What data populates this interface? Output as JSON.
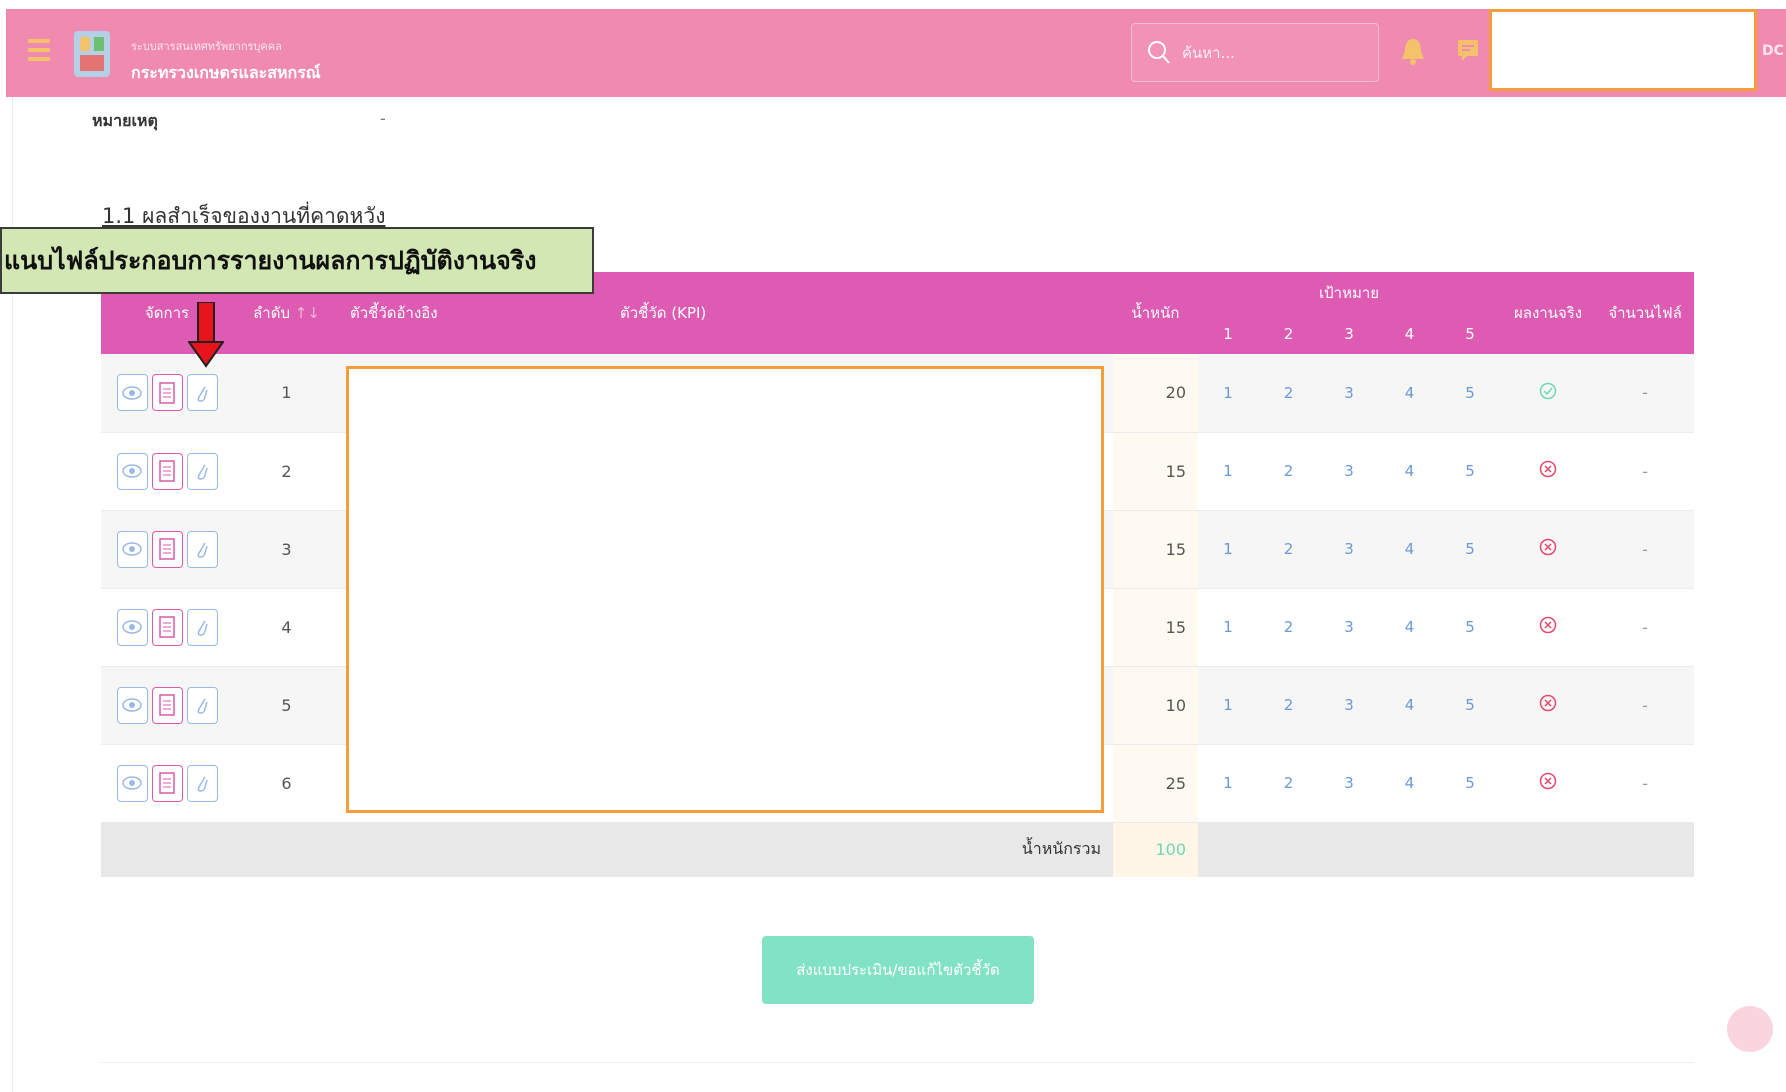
{
  "header": {
    "brand_top": "ระบบสารสนเทศทรัพยากรบุคคล",
    "brand_main": "กระทรวงเกษตรและสหกรณ์",
    "search_placeholder": "ค้นหา...",
    "user_initials": "DC"
  },
  "remark": {
    "label": "หมายเหตุ",
    "value": "-"
  },
  "section": {
    "title": "1.1 ผลสำเร็จของงานที่คาดหวัง"
  },
  "tooltip": {
    "text": "แนบไฟล์ประกอบการรายงานผลการปฏิบัติงานจริง"
  },
  "table": {
    "headers": {
      "manage": "จัดการ",
      "order": "ลำดับ",
      "ref_indicator": "ตัวชี้วัดอ้างอิง",
      "kpi": "ตัวชี้วัด (KPI)",
      "weight": "น้ำหนัก",
      "target": "เป้าหมาย",
      "targets": [
        "1",
        "2",
        "3",
        "4",
        "5"
      ],
      "actual": "ผลงานจริง",
      "file_count": "จำนวนไฟล์"
    },
    "rows": [
      {
        "order": "1",
        "weight": "20",
        "t1": "1",
        "t2": "2",
        "t3": "3",
        "t4": "4",
        "t5": "5",
        "actual": "✓",
        "files": "-"
      },
      {
        "order": "2",
        "weight": "15",
        "t1": "1",
        "t2": "2",
        "t3": "3",
        "t4": "4",
        "t5": "5",
        "actual": "✕",
        "files": "-"
      },
      {
        "order": "3",
        "weight": "15",
        "t1": "1",
        "t2": "2",
        "t3": "3",
        "t4": "4",
        "t5": "5",
        "actual": "✕",
        "files": "-"
      },
      {
        "order": "4",
        "weight": "15",
        "t1": "1",
        "t2": "2",
        "t3": "3",
        "t4": "4",
        "t5": "5",
        "actual": "✕",
        "files": "-"
      },
      {
        "order": "5",
        "weight": "10",
        "t1": "1",
        "t2": "2",
        "t3": "3",
        "t4": "4",
        "t5": "5",
        "actual": "✕",
        "files": "-"
      },
      {
        "order": "6",
        "weight": "25",
        "t1": "1",
        "t2": "2",
        "t3": "3",
        "t4": "4",
        "t5": "5",
        "actual": "✕",
        "files": "-"
      }
    ],
    "total": {
      "label": "น้ำหนักรวม",
      "value": "100"
    }
  },
  "submit": {
    "label": "ส่งแบบประเมิน/ขอแก้ไขตัวชี้วัด"
  },
  "colors": {
    "header": "#f18ab0",
    "table_header": "#dd5bb2",
    "submit": "#82e3c4",
    "success": "#6fd7b4",
    "error": "#e8486a",
    "highlight": "#f49d3b"
  },
  "icons": {
    "view": "eye-icon",
    "doc": "document-icon",
    "attach": "paperclip-icon",
    "actual_ok": "check-circle-icon",
    "actual_fail": "x-circle-icon"
  }
}
